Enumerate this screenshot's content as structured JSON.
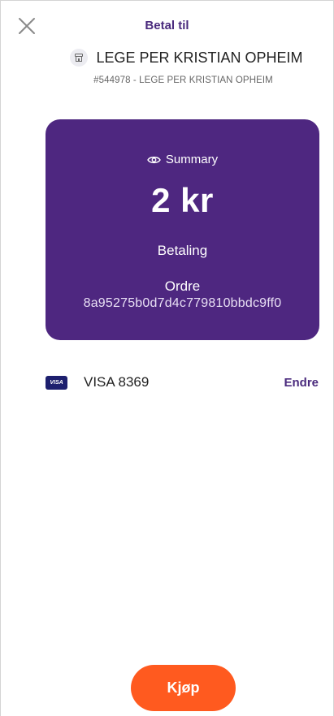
{
  "header": {
    "close_icon": "close-icon",
    "title": "Betal til"
  },
  "merchant": {
    "icon": "store-icon",
    "name": "LEGE PER KRISTIAN OPHEIM",
    "subtitle": "#544978 - LEGE PER KRISTIAN OPHEIM"
  },
  "summary": {
    "icon": "eye-icon",
    "label": "Summary",
    "amount": "2 kr",
    "payment_type": "Betaling",
    "order_label": "Ordre",
    "order_id": "8a95275b0d7d4c779810bbdc9ff0",
    "background_color": "#4e2780"
  },
  "payment_method": {
    "brand_icon": "visa-card-icon",
    "brand_mark": "VISA",
    "label": "VISA 8369",
    "change_label": "Endre"
  },
  "actions": {
    "buy_label": "Kjøp",
    "accent_color": "#ff5a1f"
  }
}
